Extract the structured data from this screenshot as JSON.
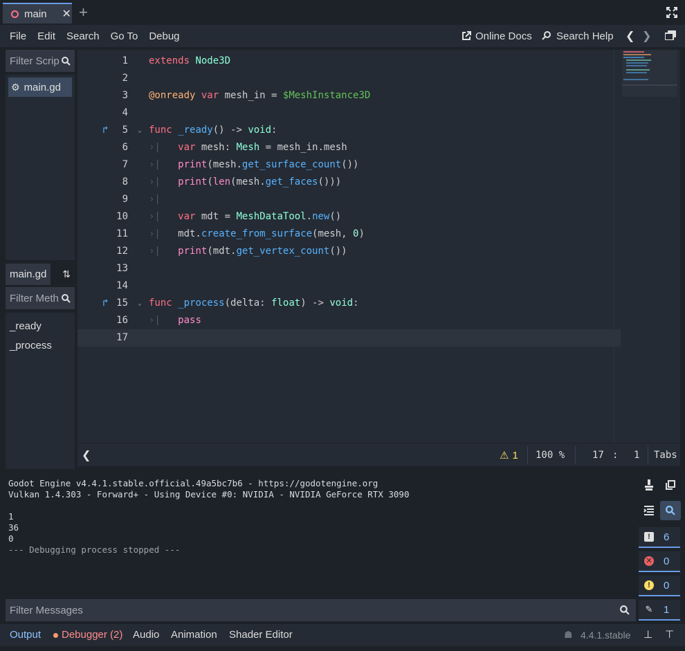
{
  "tabs": [
    {
      "label": "main",
      "close": "✕"
    }
  ],
  "add_tab": "+",
  "menu": [
    "File",
    "Edit",
    "Search",
    "Go To",
    "Debug"
  ],
  "online_docs": "Online Docs",
  "search_help": "Search Help",
  "left": {
    "filter_scripts": "Filter Scrip",
    "scripts": [
      "main.gd"
    ],
    "current_script": "main.gd",
    "filter_methods": "Filter Meth",
    "methods": [
      "_ready",
      "_process"
    ]
  },
  "code": [
    {
      "n": "1",
      "html": "<span class='kw'>extends</span> <span class='ty'>Node3D</span>"
    },
    {
      "n": "2",
      "html": ""
    },
    {
      "n": "3",
      "html": "<span class='an'>@onready</span> <span class='kw'>var</span> mesh_in = <span class='np'>$MeshInstance3D</span>"
    },
    {
      "n": "4",
      "html": ""
    },
    {
      "n": "5",
      "html": "<span class='kw'>func</span> <span class='fn'>_ready</span>() -&gt; <span class='ty'>void</span>:",
      "fold": true,
      "marker": true
    },
    {
      "n": "6",
      "html": "<span class='indent'>›|</span>   <span class='kw'>var</span> mesh: <span class='ty'>Mesh</span> = mesh_in.mesh"
    },
    {
      "n": "7",
      "html": "<span class='indent'>›|</span>   <span class='kw2'>print</span>(mesh.<span class='fn'>get_surface_count</span>())"
    },
    {
      "n": "8",
      "html": "<span class='indent'>›|</span>   <span class='kw2'>print</span>(<span class='kw2'>len</span>(mesh.<span class='fn'>get_faces</span>()))"
    },
    {
      "n": "9",
      "html": "<span class='indent'>›|</span>"
    },
    {
      "n": "10",
      "html": "<span class='indent'>›|</span>   <span class='kw'>var</span> mdt = <span class='ty'>MeshDataTool</span>.<span class='fn'>new</span>()"
    },
    {
      "n": "11",
      "html": "<span class='indent'>›|</span>   mdt.<span class='fn'>create_from_surface</span>(mesh, <span class='nm'>0</span>)"
    },
    {
      "n": "12",
      "html": "<span class='indent'>›|</span>   <span class='kw2'>print</span>(mdt.<span class='fn'>get_vertex_count</span>())"
    },
    {
      "n": "13",
      "html": ""
    },
    {
      "n": "14",
      "html": ""
    },
    {
      "n": "15",
      "html": "<span class='kw'>func</span> <span class='fn'>_process</span>(delta: <span class='ty'>float</span>) -&gt; <span class='ty'>void</span>:",
      "fold": true,
      "marker": true
    },
    {
      "n": "16",
      "html": "<span class='indent'>›|</span>   <span class='kw2'>pass</span>"
    },
    {
      "n": "17",
      "html": "",
      "current": true
    }
  ],
  "status": {
    "warnings": "1",
    "zoom": "100 %",
    "line": "17",
    "col": "1",
    "sep": ":",
    "indent": "Tabs"
  },
  "output_lines": [
    "Godot Engine v4.4.1.stable.official.49a5bc7b6 - https://godotengine.org",
    "Vulkan 1.4.303 - Forward+ - Using Device #0: NVIDIA - NVIDIA GeForce RTX 3090",
    "",
    "1",
    "36",
    "0",
    "--- Debugging process stopped ---"
  ],
  "filter_messages": "Filter Messages",
  "counts": {
    "messages": "6",
    "errors": "0",
    "warnings": "0",
    "editor": "1"
  },
  "bottom_tabs": [
    "Output",
    "Debugger (2)",
    "Audio",
    "Animation",
    "Shader Editor"
  ],
  "version": "4.4.1.stable",
  "colors": {
    "accent": "#699ce8",
    "keyword": "#ff7085",
    "type": "#8effda",
    "function": "#57b3ff",
    "error": "#e86060",
    "warning": "#ffdd65"
  }
}
